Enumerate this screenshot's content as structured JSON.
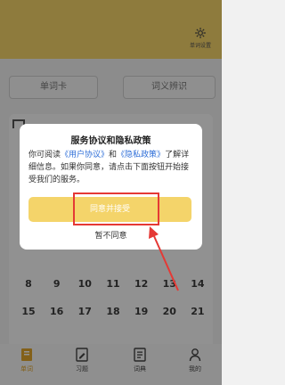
{
  "header": {
    "settings_label": "单词设置"
  },
  "tabs": [
    {
      "label": "单词卡"
    },
    {
      "label": "词义辨识"
    }
  ],
  "background_numbers": [
    "8",
    "9",
    "10",
    "11",
    "12",
    "13",
    "14",
    "15",
    "16",
    "17",
    "18",
    "19",
    "20",
    "21"
  ],
  "dialog": {
    "title": "服务协议和隐私政策",
    "body_prefix": "你可阅读",
    "link_user_agreement": "《用户协议》",
    "body_and": "和",
    "link_privacy": "《隐私政策》",
    "body_suffix": "了解详细信息。如果你同意，请点击下面按钮开始接受我们的服务。",
    "agree_label": "同意并接受",
    "disagree_label": "暂不同意"
  },
  "annotation": {
    "color": "#e53935"
  },
  "bottom_nav": [
    {
      "label": "单词",
      "icon": "book-icon",
      "active": true
    },
    {
      "label": "习题",
      "icon": "pencil-note-icon",
      "active": false
    },
    {
      "label": "词典",
      "icon": "dictionary-icon",
      "active": false
    },
    {
      "label": "我的",
      "icon": "person-icon",
      "active": false
    }
  ],
  "colors": {
    "accent": "#f4d46a",
    "link": "#2f6fd8",
    "active_nav": "#e2a62b"
  }
}
